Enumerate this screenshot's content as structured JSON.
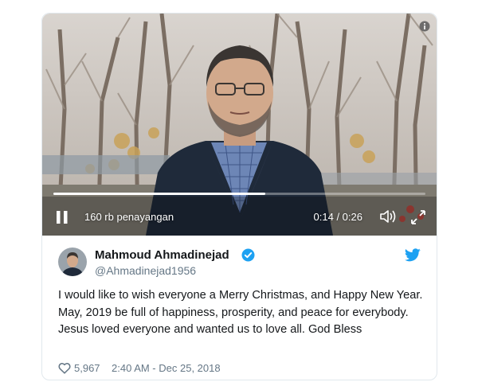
{
  "video": {
    "views": "160 rb penayangan",
    "time": "0:14 / 0:26",
    "progress_percent": 57
  },
  "tweet": {
    "author_name": "Mahmoud Ahmadinejad",
    "author_handle": "@Ahmadinejad1956",
    "verified": true,
    "text": "I would like to wish everyone a Merry Christmas, and Happy New Year. May, 2019 be full of happiness, prosperity, and peace for everybody. Jesus loved everyone and wanted us to love all. God Bless",
    "likes": "5,967",
    "timestamp": "2:40 AM - Dec 25, 2018"
  },
  "colors": {
    "twitter_blue": "#1da1f2",
    "text": "#14171a",
    "muted": "#657786",
    "border": "#e1e8ed"
  },
  "icons": [
    "info-icon",
    "pause-icon",
    "volume-icon",
    "fullscreen-icon",
    "verified-badge-icon",
    "twitter-bird-icon",
    "heart-icon"
  ]
}
